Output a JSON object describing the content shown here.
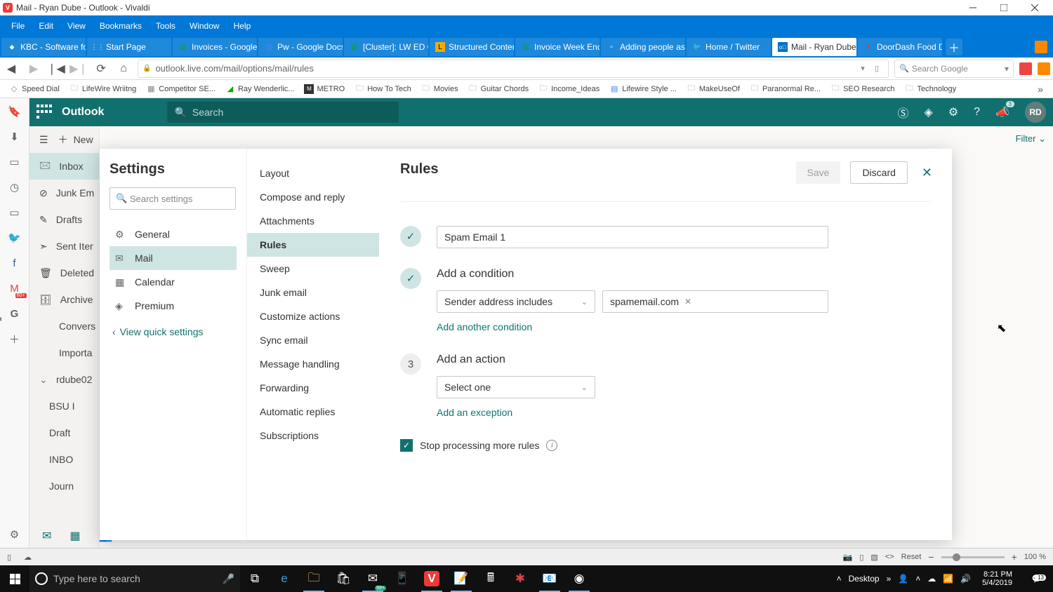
{
  "window_title": "Mail - Ryan Dube - Outlook - Vivaldi",
  "menubar": [
    "File",
    "Edit",
    "View",
    "Bookmarks",
    "Tools",
    "Window",
    "Help"
  ],
  "tabs": [
    {
      "label": "KBC - Software fo"
    },
    {
      "label": "Start Page"
    },
    {
      "label": "Invoices - Google"
    },
    {
      "label": "Pw - Google Docs"
    },
    {
      "label": "[Cluster]: LW ED O"
    },
    {
      "label": "Structured Conten"
    },
    {
      "label": "Invoice Week Endi"
    },
    {
      "label": "Adding people as"
    },
    {
      "label": "Home / Twitter"
    },
    {
      "label": "Mail - Ryan Dube"
    },
    {
      "label": "DoorDash Food D"
    }
  ],
  "active_tab_index": 9,
  "url": "outlook.live.com/mail/options/mail/rules",
  "search_placeholder": "Search Google",
  "bookmarks": [
    "Speed Dial",
    "LifeWire Wriitng",
    "Competitor SE...",
    "Ray Wenderlic...",
    "METRO",
    "How To Tech",
    "Movies",
    "Guitar Chords",
    "Income_Ideas",
    "Lifewire Style ...",
    "MakeUseOf",
    "Paranormal Re...",
    "SEO Research",
    "Technology"
  ],
  "sidepanel_gmail_badge": "60+",
  "owa": {
    "brand": "Outlook",
    "search_placeholder": "Search",
    "avatar_initials": "RD",
    "bell_badge": "3"
  },
  "folders": {
    "top_btn": "New",
    "items": [
      "Inbox",
      "Junk Em",
      "Drafts",
      "Sent Iter",
      "Deleted",
      "Archive",
      "Convers",
      "Importa"
    ],
    "account": "rdube02",
    "subfolders": [
      "BSU I",
      "Draft",
      "INBO",
      "Journ"
    ]
  },
  "filter_label": "Filter",
  "settings": {
    "title": "Settings",
    "search_placeholder": "Search settings",
    "cats": [
      "General",
      "Mail",
      "Calendar",
      "Premium"
    ],
    "selected_cat_index": 1,
    "view_quick": "View quick settings",
    "mail_subs": [
      "Layout",
      "Compose and reply",
      "Attachments",
      "Rules",
      "Sweep",
      "Junk email",
      "Customize actions",
      "Sync email",
      "Message handling",
      "Forwarding",
      "Automatic replies",
      "Subscriptions"
    ],
    "selected_sub_index": 3
  },
  "rules": {
    "title": "Rules",
    "save": "Save",
    "discard": "Discard",
    "rule_name": "Spam Email 1",
    "add_condition": "Add a condition",
    "condition_select": "Sender address includes",
    "condition_tag": "spamemail.com",
    "add_another": "Add another condition",
    "step3_num": "3",
    "add_action": "Add an action",
    "action_select": "Select one",
    "add_exception": "Add an exception",
    "stop_label": "Stop processing more rules"
  },
  "status": {
    "reset": "Reset",
    "zoom": "100 %"
  },
  "taskbar": {
    "search_placeholder": "Type here to search",
    "desktop": "Desktop",
    "time": "8:21 PM",
    "date": "5/4/2019",
    "notif_count": "13",
    "mail_badge": "99+"
  }
}
